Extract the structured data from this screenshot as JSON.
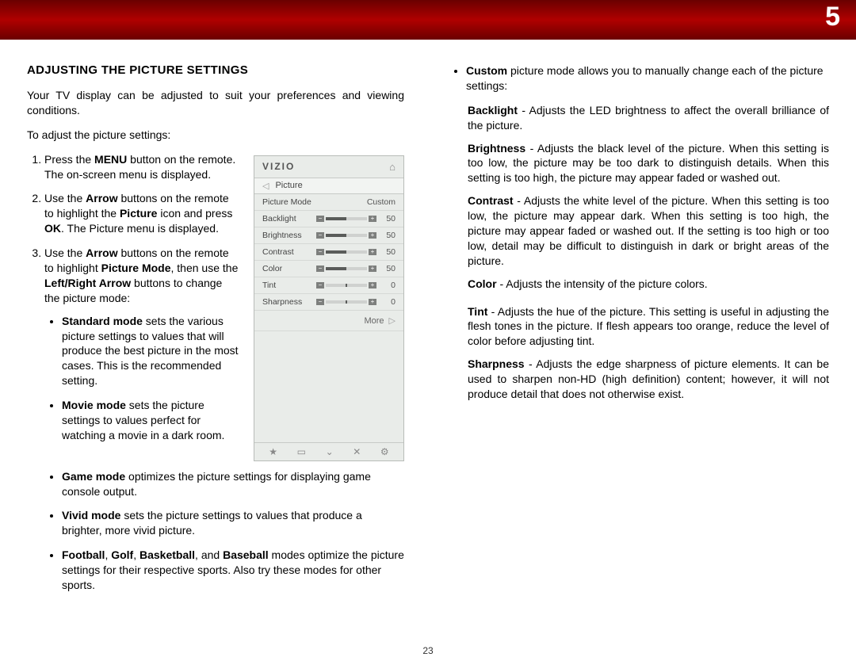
{
  "chapter_number": "5",
  "page_number": "23",
  "section_title": "ADJUSTING THE PICTURE SETTINGS",
  "intro_para": "Your TV display can be adjusted to suit your preferences and viewing conditions.",
  "steps_lead": "To adjust the picture settings:",
  "step1": {
    "pre": "Press the ",
    "b1": "MENU",
    "post": " button on the remote. The on-screen menu is displayed."
  },
  "step2": {
    "pre": "Use the ",
    "b1": "Arrow",
    "mid": " buttons on the remote to highlight the ",
    "b2": "Picture",
    "post": " icon and press ",
    "b3": "OK",
    "post2": ". The Picture menu is displayed."
  },
  "step3": {
    "pre": "Use the ",
    "b1": "Arrow",
    "mid": " buttons on the remote to highlight ",
    "b2": "Picture Mode",
    "mid2": ", then use the ",
    "b3": "Left/Right Arrow",
    "post": " buttons to change the picture mode:"
  },
  "modes": {
    "standard": {
      "name": "Standard mode",
      "desc": " sets the various picture settings to values that will produce the best picture in the most cases. This is the recommended setting."
    },
    "movie": {
      "name": "Movie mode",
      "desc": " sets the picture settings to values perfect for watching a movie in a dark room."
    },
    "game": {
      "name": "Game mode",
      "desc": " optimizes the picture settings for displaying game console output."
    },
    "vivid": {
      "name": "Vivid mode",
      "desc": " sets the picture settings to values that produce a brighter, more vivid picture."
    },
    "sports_pre": {
      "b1": "Football",
      "s1": ", ",
      "b2": "Golf",
      "s2": ", ",
      "b3": "Basketball",
      "s3": ", and ",
      "b4": "Baseball",
      "desc": " modes optimize the picture settings for their respective sports. Also try these modes for other sports."
    },
    "custom": {
      "name": "Custom",
      "desc": " picture mode allows you to manually change each of the picture settings:"
    }
  },
  "defs": {
    "backlight": {
      "name": "Backlight",
      "desc": " - Adjusts the LED brightness to affect the overall brilliance of the picture."
    },
    "brightness": {
      "name": "Brightness",
      "desc": " - Adjusts the black level of the picture. When this setting is too low, the picture may be too dark to distinguish details. When this setting is too high, the picture may appear faded or washed out."
    },
    "contrast": {
      "name": "Contrast",
      "desc": " - Adjusts the white level of the picture. When this setting is too low, the picture may appear dark. When this setting is too high, the picture may appear faded or washed out. If the setting is too high or too low, detail may be difficult to distinguish in dark or bright areas of the picture."
    },
    "color": {
      "name": "Color",
      "desc": " - Adjusts the intensity of the picture colors."
    },
    "tint": {
      "name": "Tint",
      "desc": " - Adjusts the hue of the picture. This setting is useful in adjusting the flesh tones in the picture. If flesh appears too orange, reduce the level of color before adjusting tint."
    },
    "sharpness": {
      "name": "Sharpness",
      "desc": " - Adjusts the edge sharpness of picture elements. It can be used to sharpen non-HD (high definition) content; however, it will not produce detail that does not otherwise exist."
    }
  },
  "osd": {
    "brand": "VIZIO",
    "crumb": "Picture",
    "rows": [
      {
        "label": "Picture Mode",
        "type": "text",
        "value": "Custom"
      },
      {
        "label": "Backlight",
        "type": "slider",
        "value": "50"
      },
      {
        "label": "Brightness",
        "type": "slider",
        "value": "50"
      },
      {
        "label": "Contrast",
        "type": "slider",
        "value": "50"
      },
      {
        "label": "Color",
        "type": "slider",
        "value": "50"
      },
      {
        "label": "Tint",
        "type": "slider-mid",
        "value": "0"
      },
      {
        "label": "Sharpness",
        "type": "slider-mid",
        "value": "0"
      }
    ],
    "more": "More"
  }
}
